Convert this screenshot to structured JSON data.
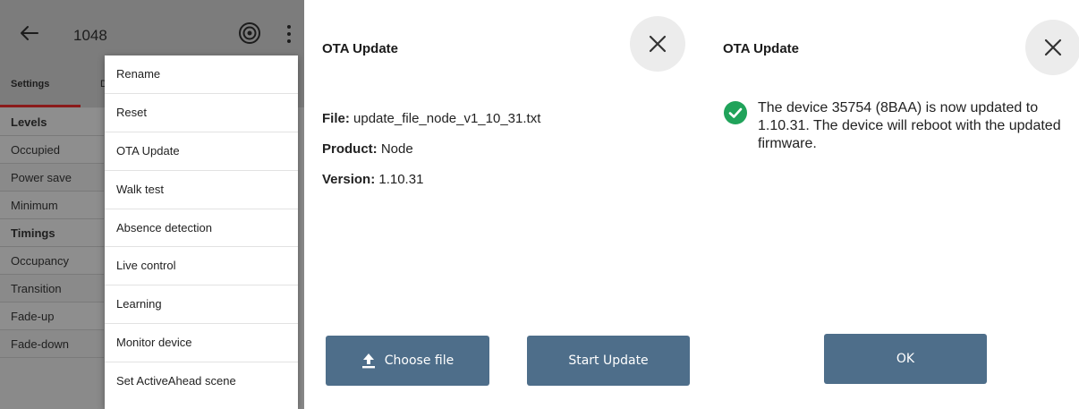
{
  "device_screen": {
    "title": "1048",
    "tabs": {
      "active": "Settings",
      "next_partial": "D"
    },
    "settings_list": [
      {
        "label": "Levels",
        "kind": "head"
      },
      {
        "label": "Occupied",
        "kind": "alt"
      },
      {
        "label": "Power save",
        "kind": "plain"
      },
      {
        "label": "Minimum",
        "kind": "alt"
      },
      {
        "label": "Timings",
        "kind": "head"
      },
      {
        "label": "Occupancy",
        "kind": "alt"
      },
      {
        "label": "Transition",
        "kind": "plain"
      },
      {
        "label": "Fade-up",
        "kind": "alt"
      },
      {
        "label": "Fade-down",
        "kind": "plain"
      }
    ],
    "menu_items": [
      "Rename",
      "Reset",
      "OTA Update",
      "Walk test",
      "Absence detection",
      "Live control",
      "Learning",
      "Monitor device",
      "Set ActiveAhead scene"
    ],
    "icons": {
      "back": "arrow-left-icon",
      "target": "target-icon",
      "overflow": "more-vert-icon"
    }
  },
  "ota_dialog": {
    "title": "OTA Update",
    "file_label": "File:",
    "file_value": "update_file_node_v1_10_31.txt",
    "product_label": "Product:",
    "product_value": "Node",
    "version_label": "Version:",
    "version_value": "1.10.31",
    "choose_file_label": "Choose file",
    "start_update_label": "Start Update"
  },
  "success_dialog": {
    "title": "OTA Update",
    "message": "The device 35754 (8BAA) is now updated to 1.10.31. The device will reboot with the updated firmware.",
    "ok_label": "OK"
  },
  "colors": {
    "accent_button": "#4e6e8a",
    "tab_underline": "#8b1a1a",
    "success_green": "#20a35a",
    "close_circle": "#ececec"
  }
}
